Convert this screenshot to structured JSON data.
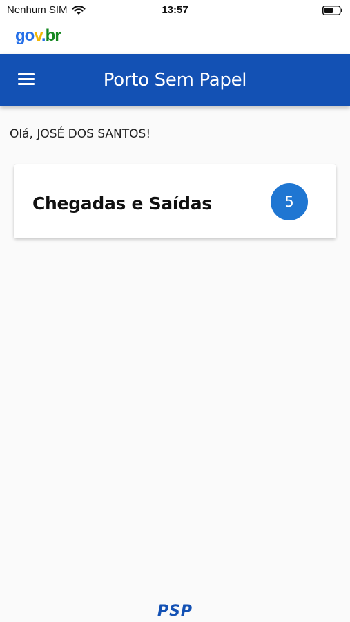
{
  "status_bar": {
    "carrier": "Nenhum SIM",
    "time": "13:57",
    "icons": [
      "wifi-icon",
      "battery-icon"
    ]
  },
  "brand": {
    "logo_parts": [
      "go",
      "v",
      ".",
      "br"
    ],
    "logo_colors": [
      "#2670e8",
      "#f2b705",
      "#2670e8",
      "#168821"
    ]
  },
  "header": {
    "title": "Porto Sem Papel",
    "menu_icon": "hamburger-menu-icon",
    "background": "#1351b4"
  },
  "main": {
    "greeting": "Olá, JOSÉ DOS SANTOS!",
    "cards": [
      {
        "title": "Chegadas e Saídas",
        "count": "5",
        "badge_color": "#1f76d2"
      }
    ]
  },
  "footer": {
    "logo_text": "PSP"
  }
}
